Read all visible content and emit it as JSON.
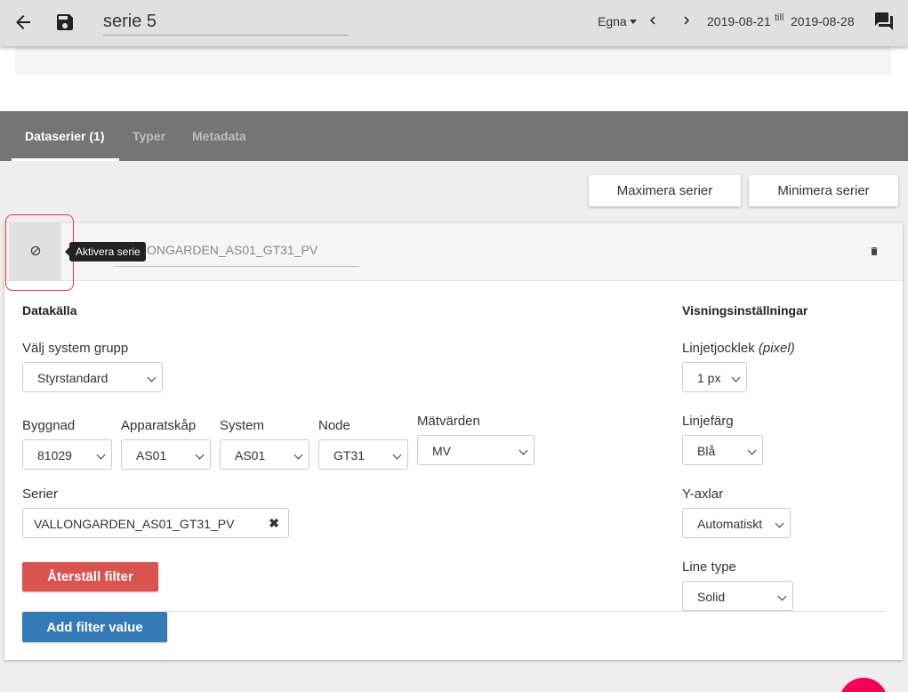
{
  "header": {
    "title": "serie 5",
    "range_label": "Egna",
    "date_from": "2019-08-21",
    "date_separator": "till",
    "date_to": "2019-08-28"
  },
  "tabs": [
    {
      "label": "Dataserier (1)",
      "active": true
    },
    {
      "label": "Typer",
      "active": false
    },
    {
      "label": "Metadata",
      "active": false
    }
  ],
  "actions": {
    "maximize_label": "Maximera serier",
    "minimize_label": "Minimera serier"
  },
  "series_card": {
    "tooltip": "Aktivera serie",
    "series_name": "ONGARDEN_AS01_GT31_PV",
    "datasource": {
      "heading": "Datakälla",
      "system_group_label": "Välj system grupp",
      "system_group_value": "Styrstandard",
      "filters": [
        {
          "label": "Byggnad",
          "value": "81029"
        },
        {
          "label": "Apparatskåp",
          "value": "AS01"
        },
        {
          "label": "System",
          "value": "AS01"
        },
        {
          "label": "Node",
          "value": "GT31"
        },
        {
          "label": "Mätvärden",
          "value": "MV"
        }
      ],
      "series_label": "Serier",
      "series_value": "VALLONGARDEN_AS01_GT31_PV",
      "reset_filter_label": "Återställ filter",
      "add_filter_label": "Add filter value"
    },
    "display": {
      "heading": "Visningsinställningar",
      "line_width_label": "Linjetjocklek",
      "line_width_unit": "(pixel)",
      "line_width_value": "1 px",
      "line_color_label": "Linjefärg",
      "line_color_value": "Blå",
      "y_axes_label": "Y-axlar",
      "y_axes_value": "Automatiskt",
      "line_type_label": "Line type",
      "line_type_value": "Solid"
    }
  },
  "colors": {
    "appbar": "#e0e0e0",
    "tabbar": "#757575",
    "danger": "#d9534f",
    "primary": "#337ab7",
    "fab": "#f50057",
    "highlight": "#e53935"
  },
  "icons": [
    "arrow-back-icon",
    "save-icon",
    "chevron-left-icon",
    "chevron-right-icon",
    "chat-icon",
    "block-icon",
    "trash-icon",
    "close-icon"
  ]
}
